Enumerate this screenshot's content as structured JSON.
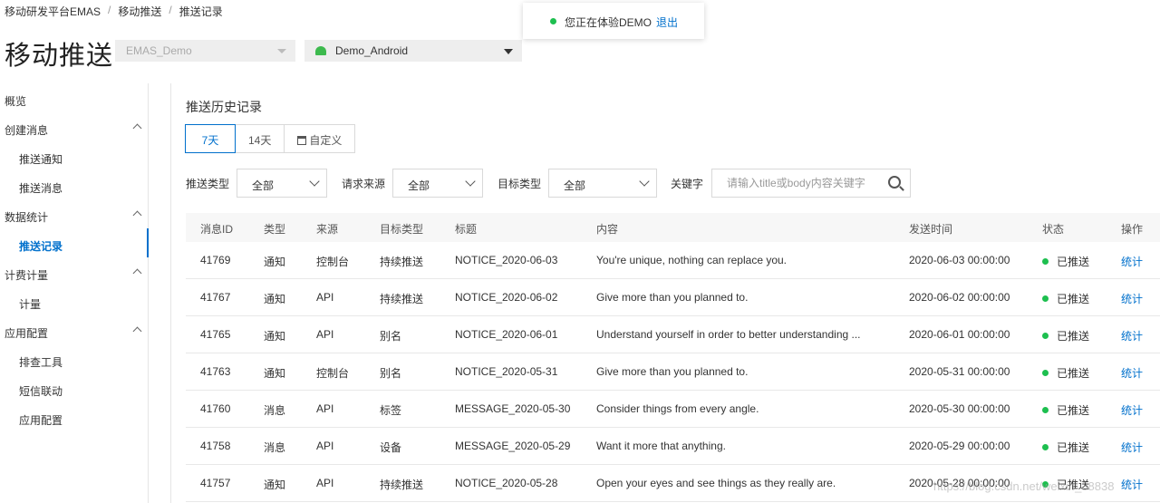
{
  "breadcrumb": {
    "items": [
      "移动研发平台EMAS",
      "移动推送",
      "推送记录"
    ],
    "sep": "/"
  },
  "page_title": "移动推送",
  "app_select": {
    "value": "EMAS_Demo"
  },
  "platform_select": {
    "value": "Demo_Android"
  },
  "demo_banner": {
    "text": "您正在体验DEMO",
    "link": "退出"
  },
  "sidebar": {
    "items": [
      {
        "label": "概览"
      },
      {
        "label": "创建消息"
      },
      {
        "label": "推送通知"
      },
      {
        "label": "推送消息"
      },
      {
        "label": "数据统计"
      },
      {
        "label": "推送记录"
      },
      {
        "label": "计费计量"
      },
      {
        "label": "计量"
      },
      {
        "label": "应用配置"
      },
      {
        "label": "排查工具"
      },
      {
        "label": "短信联动"
      },
      {
        "label": "应用配置"
      }
    ]
  },
  "section_title": "推送历史记录",
  "tabs": [
    {
      "label": "7天"
    },
    {
      "label": "14天"
    },
    {
      "label": "自定义"
    }
  ],
  "filters": {
    "push_type": {
      "label": "推送类型",
      "value": "全部"
    },
    "source": {
      "label": "请求来源",
      "value": "全部"
    },
    "target_type": {
      "label": "目标类型",
      "value": "全部"
    },
    "keyword": {
      "label": "关键字",
      "placeholder": "请输入title或body内容关键字"
    }
  },
  "table": {
    "headers": [
      "消息ID",
      "类型",
      "来源",
      "目标类型",
      "标题",
      "内容",
      "发送时间",
      "状态",
      "操作"
    ],
    "rows": [
      {
        "id": "41769",
        "type": "通知",
        "source": "控制台",
        "target": "持续推送",
        "title": "NOTICE_2020-06-03",
        "content": "You're unique, nothing can replace you.",
        "time": "2020-06-03 00:00:00",
        "status": "已推送",
        "action": "统计"
      },
      {
        "id": "41767",
        "type": "通知",
        "source": "API",
        "target": "持续推送",
        "title": "NOTICE_2020-06-02",
        "content": "Give more than you planned to.",
        "time": "2020-06-02 00:00:00",
        "status": "已推送",
        "action": "统计"
      },
      {
        "id": "41765",
        "type": "通知",
        "source": "API",
        "target": "别名",
        "title": "NOTICE_2020-06-01",
        "content": "Understand yourself in order to better understanding ...",
        "time": "2020-06-01 00:00:00",
        "status": "已推送",
        "action": "统计"
      },
      {
        "id": "41763",
        "type": "通知",
        "source": "控制台",
        "target": "别名",
        "title": "NOTICE_2020-05-31",
        "content": "Give more than you planned to.",
        "time": "2020-05-31 00:00:00",
        "status": "已推送",
        "action": "统计"
      },
      {
        "id": "41760",
        "type": "消息",
        "source": "API",
        "target": "标签",
        "title": "MESSAGE_2020-05-30",
        "content": "Consider things from every angle.",
        "time": "2020-05-30 00:00:00",
        "status": "已推送",
        "action": "统计"
      },
      {
        "id": "41758",
        "type": "消息",
        "source": "API",
        "target": "设备",
        "title": "MESSAGE_2020-05-29",
        "content": "Want it more that anything.",
        "time": "2020-05-29 00:00:00",
        "status": "已推送",
        "action": "统计"
      },
      {
        "id": "41757",
        "type": "通知",
        "source": "API",
        "target": "持续推送",
        "title": "NOTICE_2020-05-28",
        "content": "Open your eyes and see things as they really are.",
        "time": "2020-05-28 00:00:00",
        "status": "已推送",
        "action": "统计"
      }
    ]
  },
  "watermark": "https://blog.csdn.net/weixin_38838",
  "colors": {
    "accent": "#0070cc",
    "status_green": "#1dbf4f"
  },
  "icons": [
    "android-icon",
    "calendar-icon",
    "search-icon",
    "chevron-down-icon",
    "chevron-up-icon"
  ]
}
